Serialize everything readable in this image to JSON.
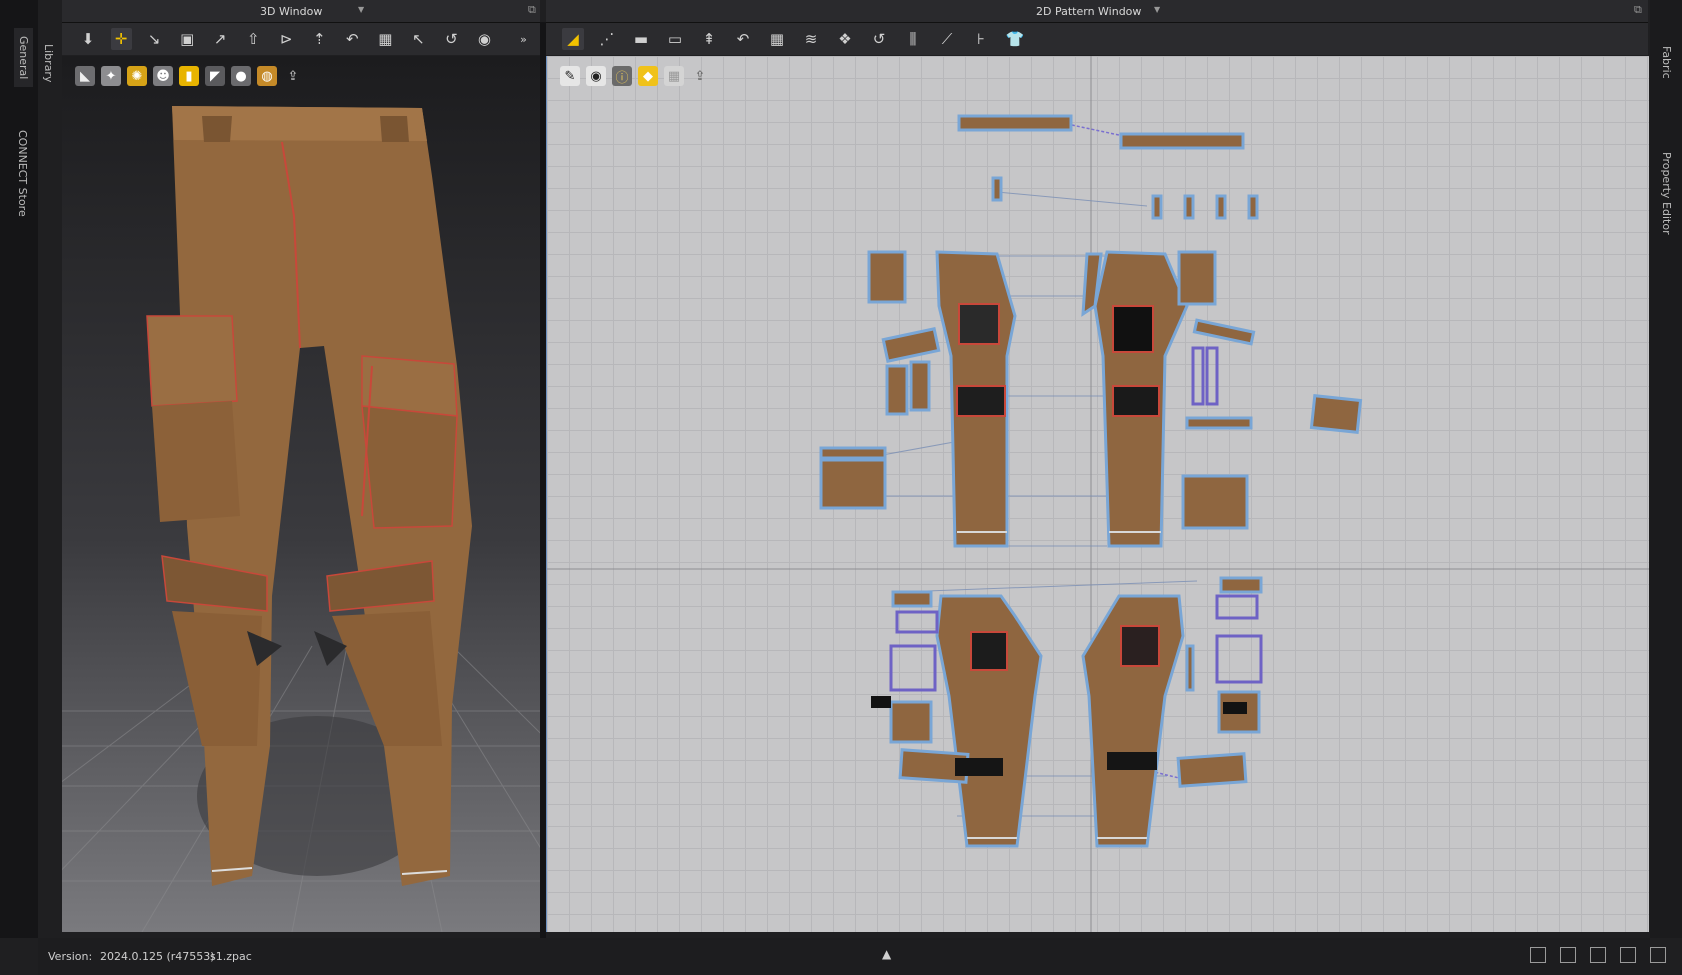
{
  "left_rail": {
    "tabs": [
      "General",
      "Library",
      "CONNECT Store"
    ]
  },
  "right_rail": {
    "tabs": [
      "Fabric",
      "Property Editor"
    ]
  },
  "window_3d": {
    "title": "3D Window",
    "toolbar_icons": [
      "select-move-icon",
      "transform-icon",
      "edit-pattern-icon",
      "fold-icon",
      "sewing-icon",
      "arrangement-icon",
      "avatar-icon",
      "pin-icon",
      "tack-icon",
      "grid-icon",
      "measure-icon",
      "hanger-icon",
      "record-icon"
    ],
    "sub_icons": [
      "cloth-display-icon",
      "texture-icon",
      "physics-icon",
      "avatar-display-icon",
      "color-icon",
      "highlight-icon",
      "person-icon",
      "globe-icon",
      "export-icon"
    ]
  },
  "window_2d": {
    "title": "2D Pattern Window",
    "toolbar_icons": [
      "polygon-icon",
      "internal-point-icon",
      "rectangle-icon",
      "circle-icon",
      "dart-icon",
      "trace-icon",
      "grid-pattern-icon",
      "fold-icon",
      "seam-icon",
      "segment-icon",
      "parallel-lines-icon",
      "measure-icon",
      "align-icon",
      "garment-icon"
    ],
    "sub_icons": [
      "edit-icon",
      "eye-icon",
      "info-icon",
      "yellow-tag-icon",
      "grey-icon",
      "upload-icon"
    ]
  },
  "status": {
    "version_label": "Version:",
    "version_value": "2024.0.125 (r47553)",
    "file": "s1.zpac"
  },
  "colors": {
    "fabric": "#94683f",
    "fabric_dark": "#7d5734",
    "seam": "#c8483a",
    "outline": "#79a6d6",
    "grid_bg": "#c6c6c8"
  }
}
